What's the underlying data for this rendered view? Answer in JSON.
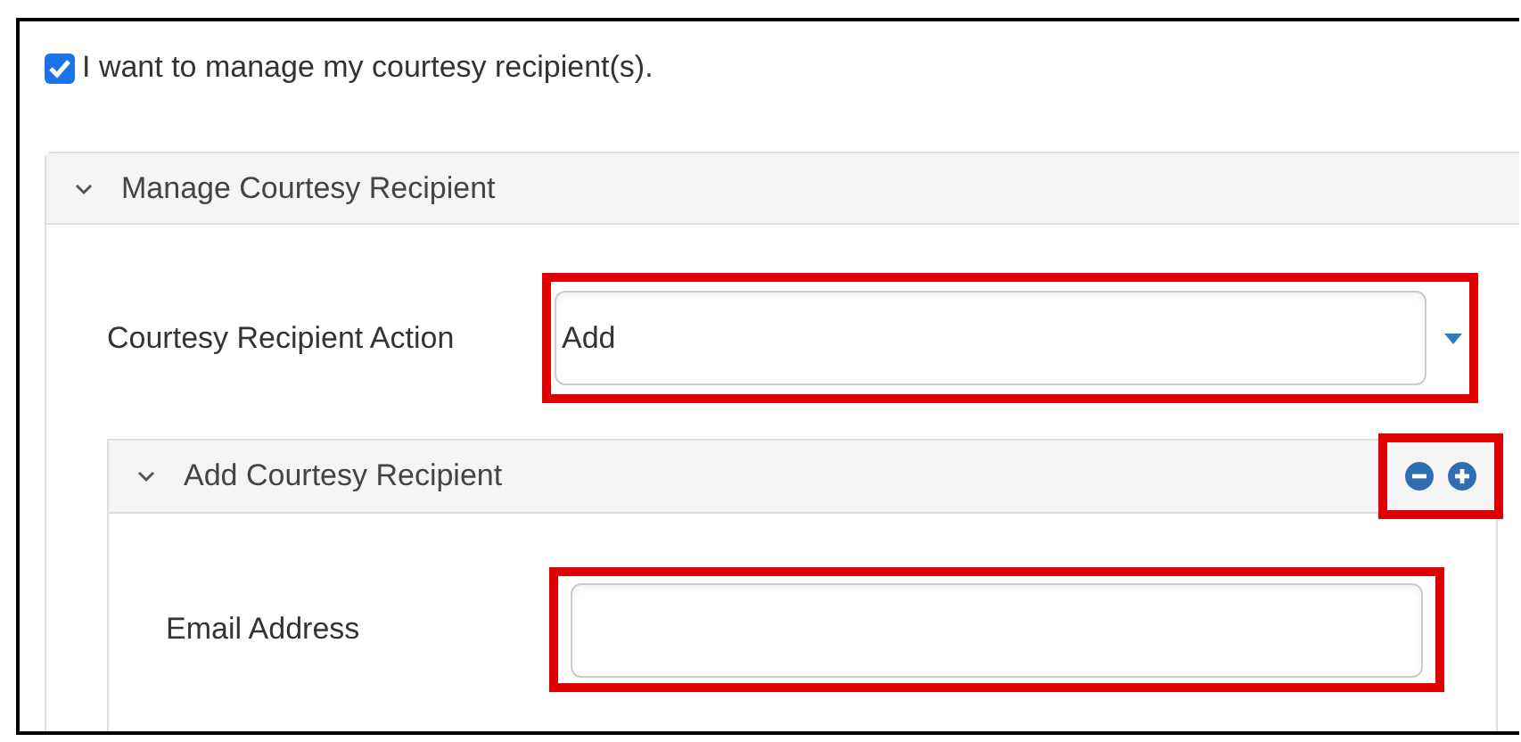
{
  "consent": {
    "label": "I want to manage my courtesy recipient(s).",
    "checked": true
  },
  "manage_panel": {
    "title": "Manage Courtesy Recipient",
    "expanded": true,
    "action_field": {
      "label": "Courtesy Recipient Action",
      "value": "Add"
    },
    "add_panel": {
      "title": "Add Courtesy Recipient",
      "expanded": true,
      "email_field": {
        "label": "Email Address"
      }
    }
  }
}
